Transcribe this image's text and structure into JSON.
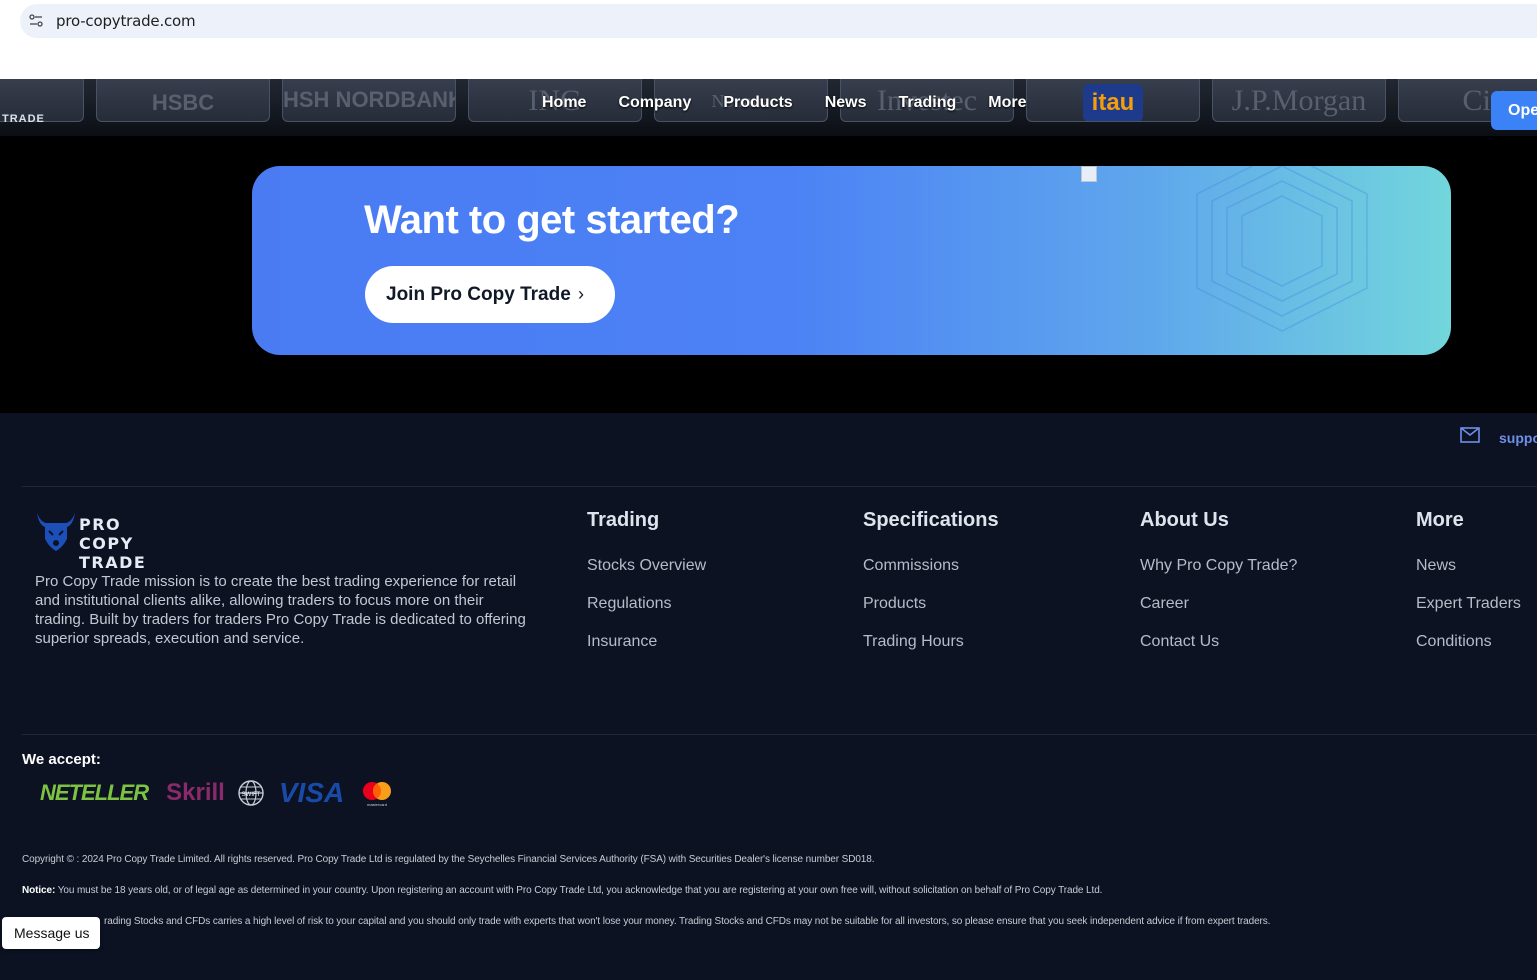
{
  "browser": {
    "url": "pro-copytrade.com"
  },
  "header": {
    "brand_small": "TRADE",
    "banks": [
      "HSBC",
      "HSH NORDBANK",
      "ING",
      "Nomura",
      "Investec",
      "itau",
      "J.P.Morgan",
      "Citi"
    ],
    "nav": [
      "Home",
      "Company",
      "Products",
      "News",
      "Trading",
      "More"
    ],
    "open_button": "Ope"
  },
  "cta": {
    "title": "Want to get started?",
    "button": "Join Pro Copy Trade",
    "button_chevron": "›"
  },
  "footer": {
    "support_email_partial": "suppo",
    "logo_line1": "PRO",
    "logo_line2": "COPY TRADE",
    "mission": "Pro Copy Trade mission is to create the best trading experience for retail and institutional clients alike, allowing traders to focus more on their trading. Built by traders for traders Pro Copy Trade is dedicated to offering superior spreads, execution and service.",
    "columns": [
      {
        "title": "Trading",
        "links": [
          "Stocks Overview",
          "Regulations",
          "Insurance"
        ]
      },
      {
        "title": "Specifications",
        "links": [
          "Commissions",
          "Products",
          "Trading Hours"
        ]
      },
      {
        "title": "About Us",
        "links": [
          "Why Pro Copy Trade?",
          "Career",
          "Contact Us"
        ]
      },
      {
        "title": "More",
        "links": [
          "News",
          "Expert Traders",
          "Conditions"
        ]
      }
    ],
    "we_accept": "We accept:",
    "payments": {
      "neteller": "NETELLER",
      "skrill": "Skrill",
      "swift": "SWIFT",
      "visa": "VISA",
      "mastercard": "mastercard"
    },
    "copyright": "Copyright © : 2024 Pro Copy Trade Limited. All rights reserved. Pro Copy Trade Ltd is regulated by the Seychelles Financial Services Authority (FSA) with Securities Dealer's license number SD018.",
    "notice_label": "Notice:",
    "notice": "You must be 18 years old, or of legal age as determined in your country. Upon registering an account with Pro Copy Trade Ltd, you acknowledge that you are registering at your own free will, without solicitation on behalf of Pro Copy Trade Ltd.",
    "risk": "rading Stocks and CFDs carries a high level of risk to your capital and you should only trade with experts that won't lose your money. Trading Stocks and CFDs may not be suitable for all investors, so please ensure that you seek independent advice if from expert traders."
  },
  "chat": {
    "button": "Message us"
  },
  "colors": {
    "accent": "#3b82f6",
    "footer_bg": "#0c1221"
  }
}
